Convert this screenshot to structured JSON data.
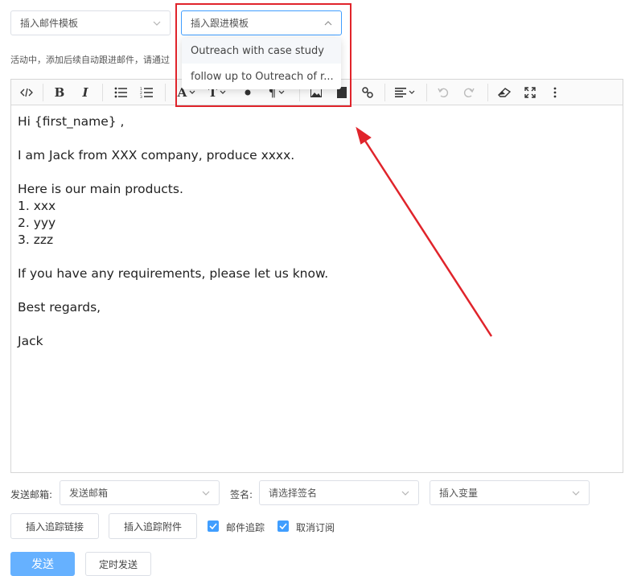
{
  "top": {
    "template_select": {
      "value": "插入邮件模板"
    },
    "followup_select": {
      "value": "插入跟进模板"
    },
    "hint": "活动中，添加后续自动跟进邮件，请通过"
  },
  "followup_dropdown": {
    "items": [
      {
        "label": "Outreach with case study"
      },
      {
        "label": "follow up to Outreach of r..."
      }
    ]
  },
  "toolbar": {
    "code": "code-view-icon",
    "bold": "B",
    "italic": "I",
    "font_color": "A",
    "font_size": "T",
    "paragraph": "¶"
  },
  "email_body": {
    "lines": [
      "Hi {first_name} ,",
      "",
      "I am Jack from XXX company, produce xxxx.",
      "",
      "Here is our main products.",
      "1. xxx",
      "2. yyy",
      "3. zzz",
      "",
      "If you have any requirements, please let us know.",
      "",
      "Best regards,",
      "",
      "Jack"
    ]
  },
  "footer": {
    "sender_label": "发送邮箱:",
    "sender_select": "发送邮箱",
    "signature_label": "签名:",
    "signature_select": "请选择签名",
    "variable_select": "插入变量",
    "insert_link_button": "插入追踪链接",
    "insert_attachment_button": "插入追踪附件",
    "email_tracking_label": "邮件追踪",
    "unsubscribe_label": "取消订阅",
    "send_button": "发送",
    "schedule_button": "定时发送"
  },
  "colors": {
    "accent": "#409eff",
    "send_button": "#66b1ff",
    "annotation_red": "#e0242b"
  }
}
